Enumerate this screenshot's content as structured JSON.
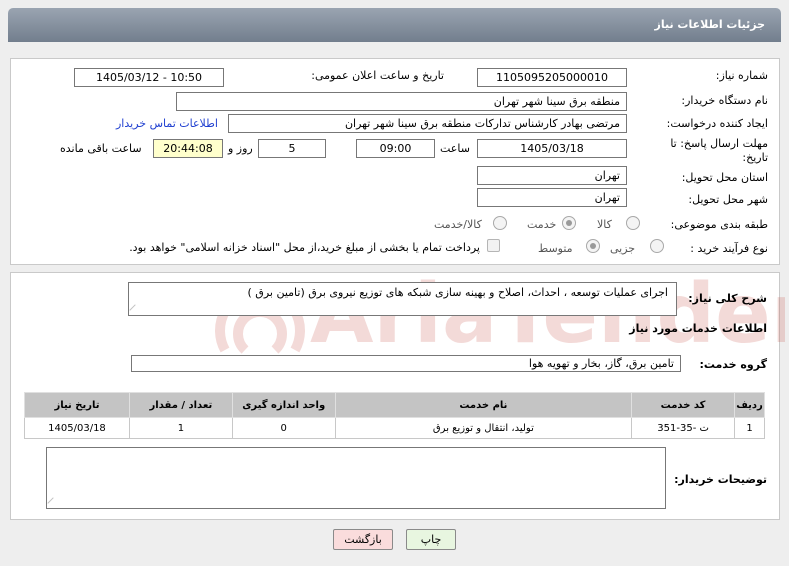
{
  "page": {
    "title": "جزئیات اطلاعات نیاز"
  },
  "form": {
    "need_number_label": "شماره نیاز:",
    "need_number": "1105095205000010",
    "announce_label": "تاریخ و ساعت اعلان عمومی:",
    "announce_value": "1405/03/12 - 10:50",
    "buyer_org_label": "نام دستگاه خریدار:",
    "buyer_org": "منطقه برق سینا شهر تهران",
    "creator_label": "ایجاد کننده درخواست:",
    "creator": "مرتضی بهادر کارشناس تدارکات منطقه برق سینا شهر تهران",
    "contact_link": "اطلاعات تماس خریدار",
    "deadline_label": "مهلت ارسال پاسخ: تا تاریخ:",
    "deadline_date": "1405/03/18",
    "time_label": "ساعت",
    "deadline_time": "09:00",
    "days_value": "5",
    "days_label": "روز و",
    "remaining_time": "20:44:08",
    "remaining_label": "ساعت باقی مانده",
    "province_label": "استان محل تحویل:",
    "province": "تهران",
    "city_label": "شهر محل تحویل:",
    "city": "تهران",
    "category_label": "طبقه بندی موضوعی:",
    "category_options": [
      "کالا",
      "خدمت",
      "کالا/خدمت"
    ],
    "process_label": "نوع فرآیند خرید :",
    "process_options": [
      "جزیی",
      "متوسط"
    ],
    "payment_note": "پرداخت تمام یا بخشی از مبلغ خرید،از محل \"اسناد خزانه اسلامی\" خواهد بود."
  },
  "summary": {
    "label": "شرح کلی نیاز:",
    "text": "اجرای عملیات توسعه ، احداث، اصلاح و بهینه سازی شبکه های توزیع نیروی برق (تامین برق )"
  },
  "services": {
    "section_title": "اطلاعات خدمات مورد نیاز",
    "group_label": "گروه خدمت:",
    "group_value": "تامین برق، گاز، بخار و تهویه هوا",
    "columns": [
      "ردیف",
      "کد خدمت",
      "نام خدمت",
      "واحد اندازه گیری",
      "تعداد / مقدار",
      "تاریخ نیاز"
    ],
    "rows": [
      {
        "row": "1",
        "code": "ت -35-351",
        "name": "تولید، انتقال و توزیع برق",
        "unit": "0",
        "qty": "1",
        "date": "1405/03/18"
      }
    ]
  },
  "buyer_notes": {
    "label": "توضیحات خریدار:",
    "text": ""
  },
  "buttons": {
    "print": "چاپ",
    "back": "بازگشت"
  },
  "watermark": {
    "text": "AriaTender.net"
  },
  "colors": {
    "title_bar": "#8591a0",
    "link": "#1f3fd0",
    "highlight": "#ffffcc",
    "back_button": "#fadcdc",
    "print_button": "#e8f6e0",
    "watermark": "#c0392b"
  }
}
